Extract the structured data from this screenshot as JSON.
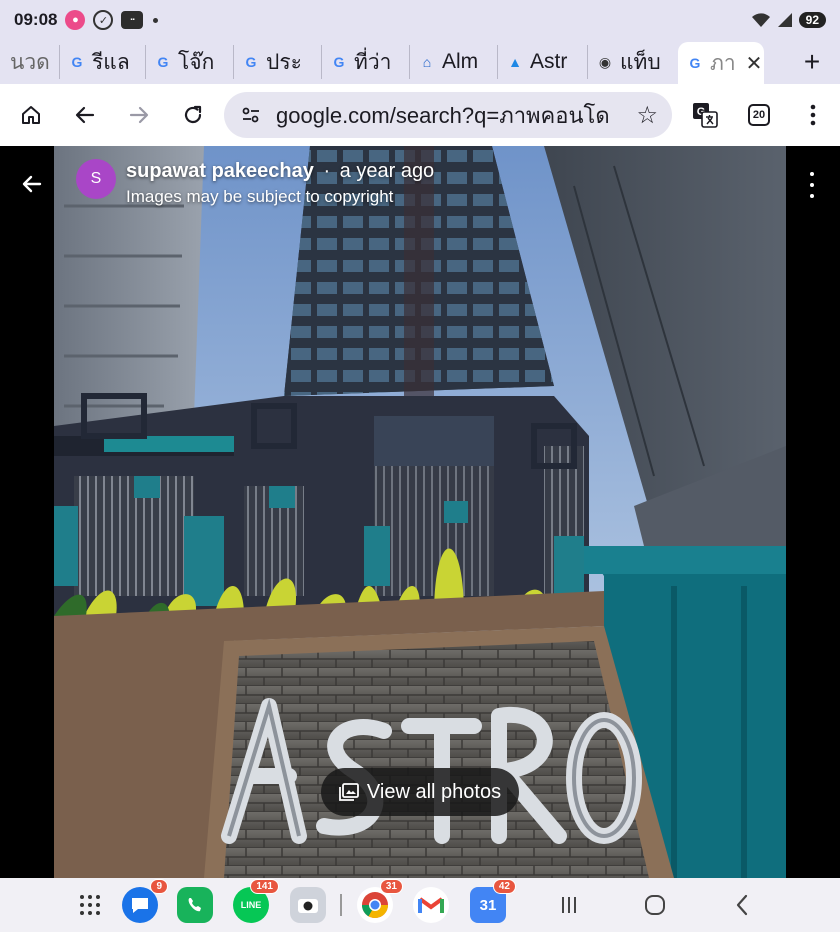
{
  "status_bar": {
    "time": "09:08",
    "battery": "92",
    "icons": [
      "app-notification-icon",
      "check-circle-icon",
      "app-icon",
      "dot-icon",
      "wifi-icon",
      "signal-icon"
    ]
  },
  "tabs": [
    {
      "label": "นวด",
      "favicon": "thai-icon"
    },
    {
      "label": "รีแล",
      "favicon": "google-icon"
    },
    {
      "label": "โจ๊ก",
      "favicon": "google-icon"
    },
    {
      "label": "ประ",
      "favicon": "google-icon"
    },
    {
      "label": "ที่ว่า",
      "favicon": "google-icon"
    },
    {
      "label": "Alm",
      "favicon": "house-icon"
    },
    {
      "label": "Astr",
      "favicon": "mountain-icon"
    },
    {
      "label": "แท็บ",
      "favicon": "chrome-icon"
    },
    {
      "label": "ภา",
      "favicon": "google-icon"
    }
  ],
  "toolbar": {
    "url": "google.com/search?q=ภาพคอนโด",
    "tab_count": "20"
  },
  "viewer": {
    "avatar_letter": "S",
    "author": "supawat pakeechay",
    "separator": "·",
    "posted": "a year ago",
    "copyright": "Images may be subject to copyright",
    "view_all_label": "View all photos",
    "photo_sign_text": "ASTRO"
  },
  "dock": {
    "apps": [
      {
        "name": "messages",
        "badge": "9",
        "color": "#1a73e8"
      },
      {
        "name": "phone",
        "badge": "",
        "color": "#18b35b"
      },
      {
        "name": "line",
        "badge": "141",
        "color": "#06c755"
      },
      {
        "name": "camera",
        "badge": "",
        "color": "#cfd3db"
      },
      {
        "name": "chrome",
        "badge": "31",
        "color": "#ffffff"
      },
      {
        "name": "gmail",
        "badge": "",
        "color": "#ffffff"
      },
      {
        "name": "calendar",
        "badge": "42",
        "color": "#4285f4"
      }
    ],
    "calendar_day": "31"
  }
}
